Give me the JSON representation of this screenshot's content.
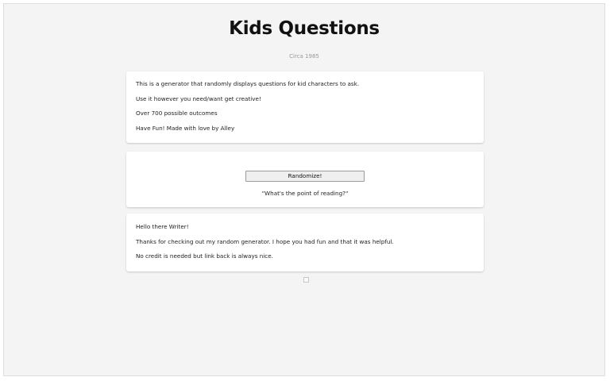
{
  "header": {
    "title": "Kids Questions",
    "subtitle": "Circa 1985"
  },
  "intro": {
    "lines": [
      "This is a generator that randomly displays questions for kid characters to ask.",
      "Use it however you need/want get creative!",
      "Over 700 possible outcomes",
      "Have Fun! Made with love by Alley"
    ]
  },
  "generator": {
    "button_label": "Randomize!",
    "result": "\"What's the point of reading?\""
  },
  "outro": {
    "lines": [
      "Hello there Writer!",
      "Thanks for checking out my random generator. I hope you had fun and that it was helpful.",
      "No credit is needed but link back is always nice."
    ]
  },
  "footer": {
    "icon": "small-square-icon"
  }
}
